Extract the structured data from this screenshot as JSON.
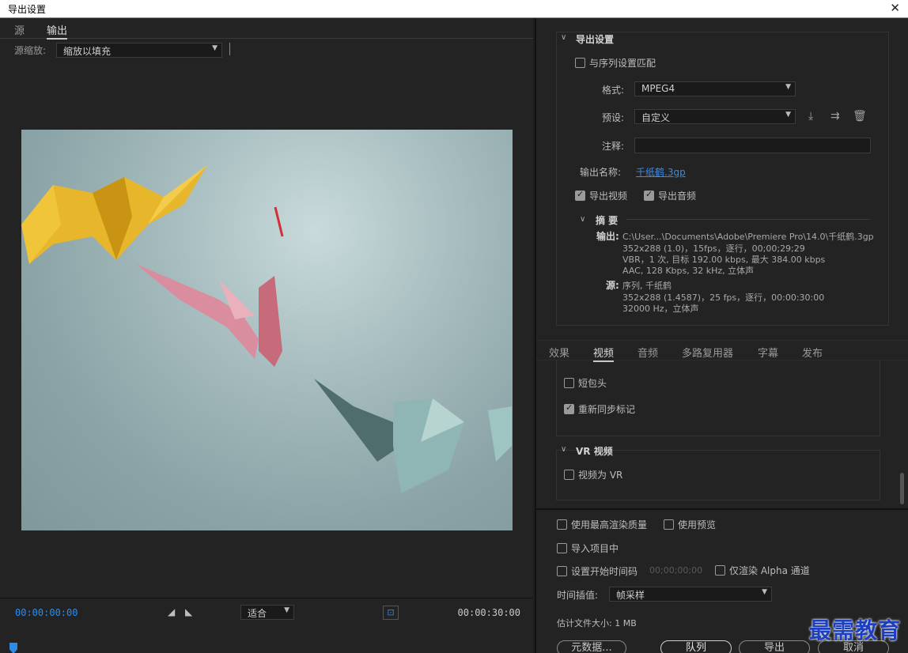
{
  "window": {
    "title": "导出设置",
    "close_glyph": "✕"
  },
  "left": {
    "tabs": [
      {
        "label": "源"
      },
      {
        "label": "输出"
      }
    ],
    "zoom": {
      "label": "源缩放:",
      "value": "缩放以填充"
    },
    "timeline": {
      "timecode_start": "00:00:00:00",
      "timecode_end": "00:00:30:00",
      "fit_value": "适合",
      "playhead_position": 0.0
    }
  },
  "export_settings": {
    "heading": "导出设置",
    "match_sequence": {
      "label": "与序列设置匹配",
      "checked": false
    },
    "format": {
      "label": "格式:",
      "value": "MPEG4"
    },
    "preset": {
      "label": "预设:",
      "value": "自定义"
    },
    "comments": {
      "label": "注释:",
      "value": ""
    },
    "output_name": {
      "label": "输出名称:",
      "value": "千纸鹤.3gp"
    },
    "export_video": {
      "label": "导出视频",
      "checked": true
    },
    "export_audio": {
      "label": "导出音频",
      "checked": true
    },
    "summary": {
      "heading": "摘 要",
      "output_key": "输出:",
      "output_lines": [
        "C:\\User...\\Documents\\Adobe\\Premiere  Pro\\14.0\\千纸鹤.3gp",
        "352x288 (1.0)，15fps，逐行，00;00;29;29",
        "VBR，1 次, 目标 192.00 kbps, 最大 384.00 kbps",
        "AAC, 128 Kbps, 32  kHz, 立体声"
      ],
      "source_key": "源:",
      "source_lines": [
        "序列, 千纸鹤",
        "352x288 (1.4587)，25 fps，逐行，00:00:30:00",
        "32000 Hz，立体声"
      ]
    }
  },
  "settings_tabs": [
    {
      "label": "效果"
    },
    {
      "label": "视频"
    },
    {
      "label": "音频"
    },
    {
      "label": "多路复用器"
    },
    {
      "label": "字幕"
    },
    {
      "label": "发布"
    }
  ],
  "video_options": {
    "short_leader": {
      "label": "短包头",
      "checked": false
    },
    "resync_markers": {
      "label": "重新同步标记",
      "checked": true
    }
  },
  "vr": {
    "heading": "VR 视频",
    "video_is_vr": {
      "label": "视频为 VR",
      "checked": false
    }
  },
  "bottom": {
    "max_render_quality": {
      "label": "使用最高渲染质量",
      "checked": false
    },
    "use_previews": {
      "label": "使用预览",
      "checked": false
    },
    "import_into_project": {
      "label": "导入项目中",
      "checked": false
    },
    "set_start_timecode": {
      "label": "设置开始时间码",
      "checked": false,
      "value": "00;00;00;00"
    },
    "render_alpha": {
      "label": "仅渲染 Alpha 通道",
      "checked": false
    },
    "time_interpolation": {
      "label": "时间插值:",
      "value": "帧采样"
    },
    "file_size": "估计文件大小: 1 MB",
    "buttons": {
      "metadata": "元数据...",
      "queue": "队列",
      "export": "导出",
      "cancel": "取消"
    }
  },
  "watermark": "最需教育"
}
